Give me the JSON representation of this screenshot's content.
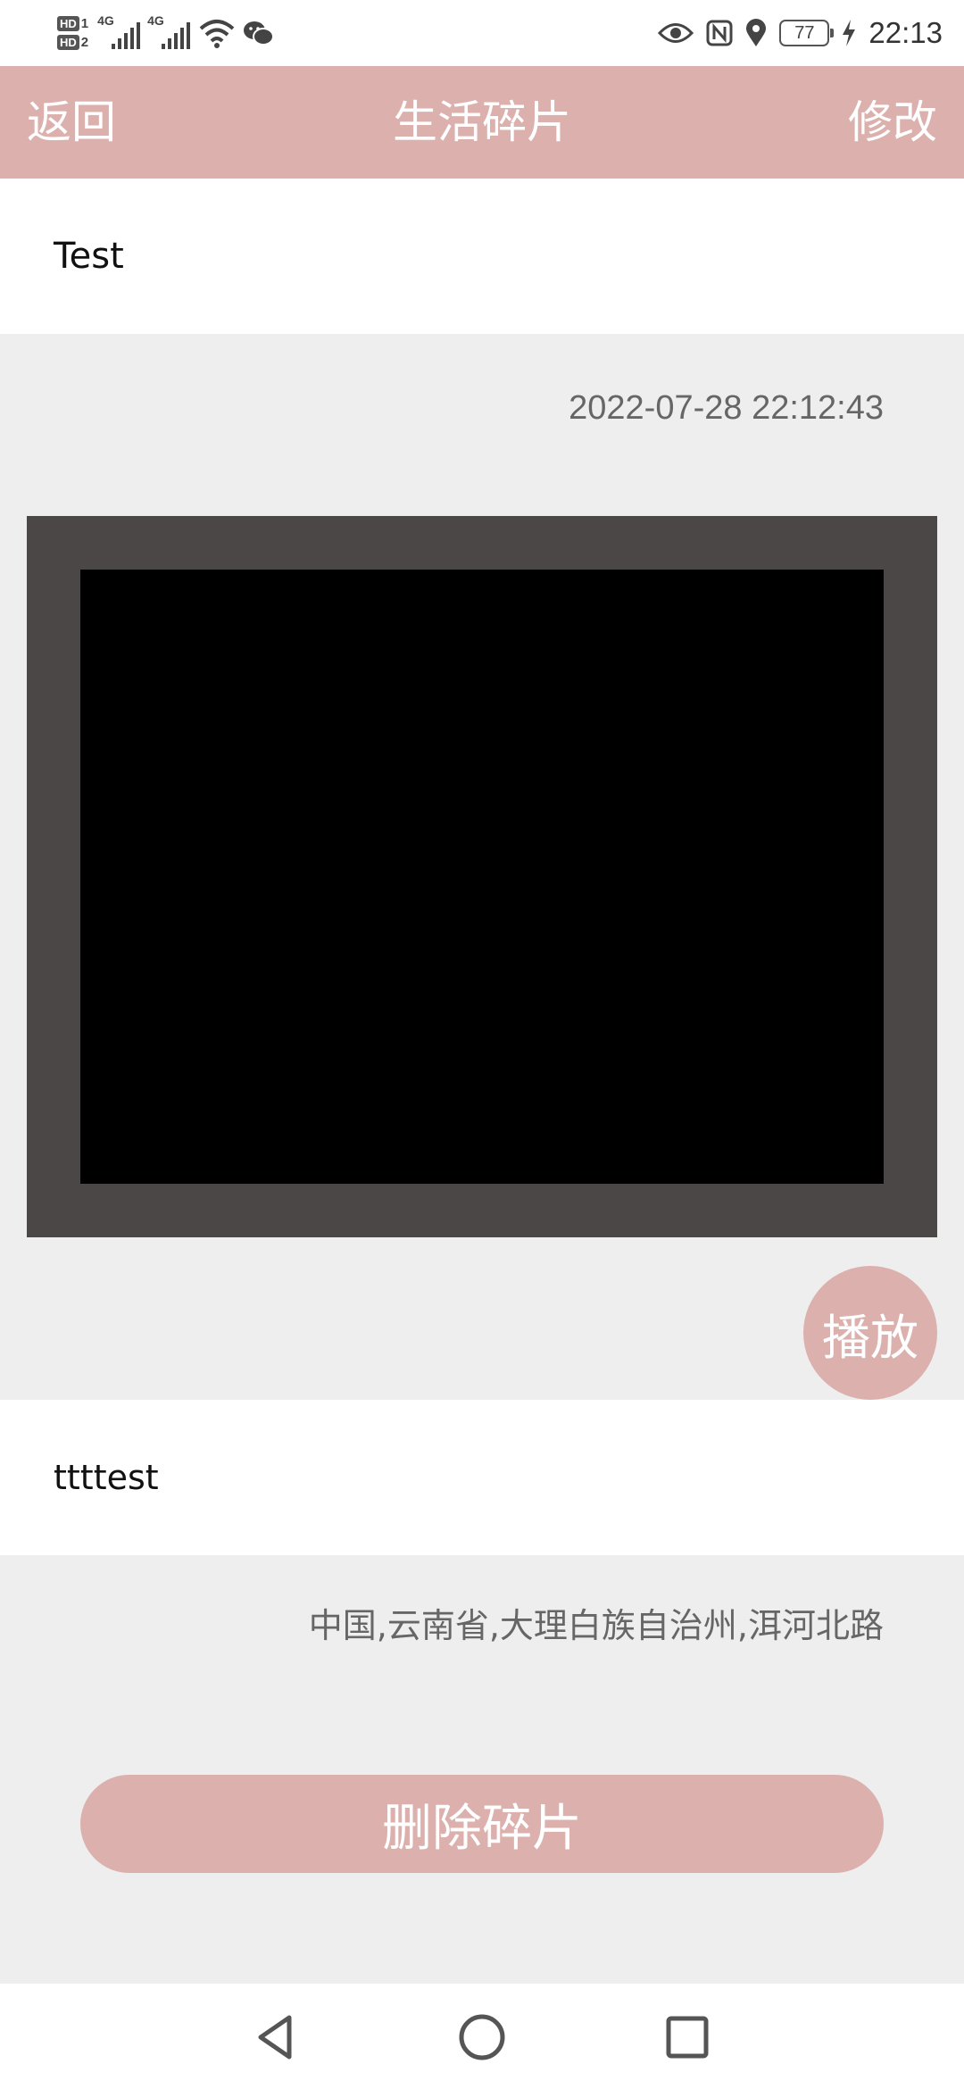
{
  "status_bar": {
    "sim1_badge": "HD",
    "sim1_num": "1",
    "sim2_badge": "HD",
    "sim2_num": "2",
    "signal1_type": "4G",
    "signal2_type": "4G",
    "battery": "77",
    "time": "22:13",
    "icons": [
      "signal-icon",
      "signal-icon",
      "wifi-icon",
      "wechat-icon",
      "eye-icon",
      "nfc-icon",
      "location-icon",
      "battery-icon",
      "charging-icon"
    ]
  },
  "header": {
    "back_label": "返回",
    "title": "生活碎片",
    "edit_label": "修改"
  },
  "fragment": {
    "title": "Test",
    "timestamp": "2022-07-28 22:12:43",
    "play_label": "播放",
    "content": "ttttest",
    "location": "中国,云南省,大理白族自治州,洱河北路",
    "delete_label": "删除碎片"
  },
  "nav": {
    "icons": [
      "back-triangle-icon",
      "home-circle-icon",
      "recents-square-icon"
    ]
  },
  "colors": {
    "accent": "#dbb0ad",
    "background": "#eeeeee",
    "video_frame": "#4b4747"
  }
}
